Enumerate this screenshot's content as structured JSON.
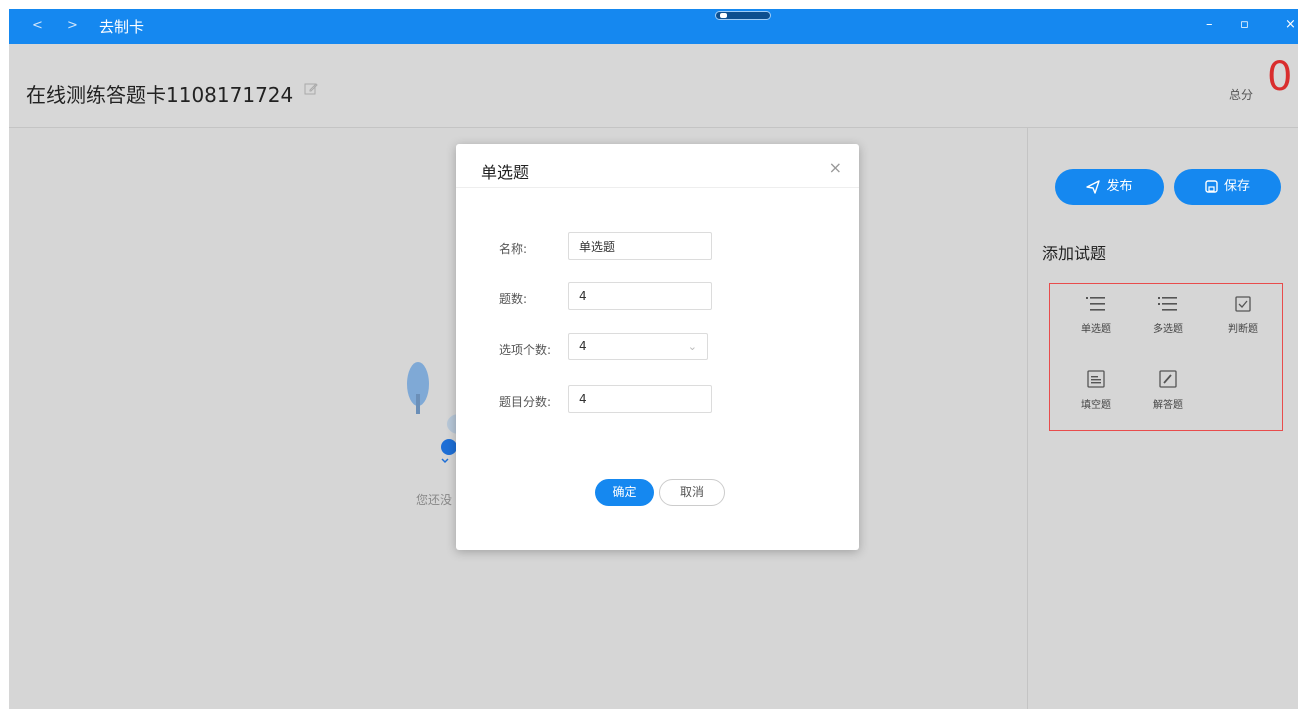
{
  "titlebar": {
    "back": "<",
    "forward": ">",
    "title": "去制卡",
    "minimize": "–",
    "maximize": "▫",
    "close": "×"
  },
  "header": {
    "title": "在线测练答题卡1108171724",
    "score_label": "总分",
    "score_value": "0"
  },
  "main": {
    "empty_text": "您还没"
  },
  "sidebar": {
    "publish_label": "发布",
    "save_label": "保存",
    "heading": "添加试题",
    "question_types": [
      {
        "label": "单选题",
        "icon": "list-icon"
      },
      {
        "label": "多选题",
        "icon": "list-icon"
      },
      {
        "label": "判断题",
        "icon": "checkbox-icon"
      },
      {
        "label": "填空题",
        "icon": "fill-blank-icon"
      },
      {
        "label": "解答题",
        "icon": "pen-box-icon"
      }
    ]
  },
  "dialog": {
    "title": "单选题",
    "close": "×",
    "fields": {
      "name_label": "名称:",
      "name_value": "单选题",
      "count_label": "题数:",
      "count_value": "4",
      "options_label": "选项个数:",
      "options_value": "4",
      "score_label": "题目分数:",
      "score_value": "4"
    },
    "confirm_label": "确定",
    "cancel_label": "取消"
  },
  "colors": {
    "accent": "#1588f0",
    "score": "#d92d2d",
    "highlight_border": "#e84c4c"
  }
}
